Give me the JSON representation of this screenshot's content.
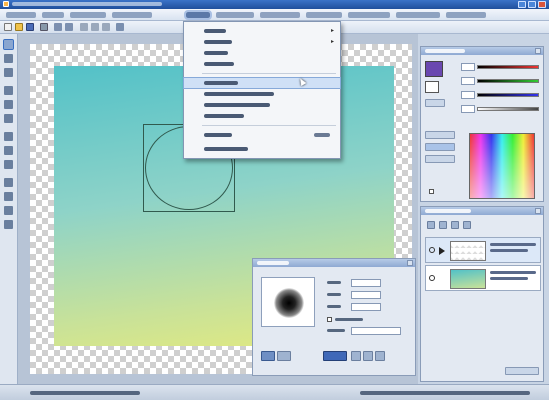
{
  "window": {
    "title": "",
    "controls": [
      "minimize",
      "maximize",
      "close"
    ]
  },
  "menubar": {
    "items": [
      {
        "label": "",
        "active": false
      },
      {
        "label": "",
        "active": false
      },
      {
        "label": "",
        "active": false
      },
      {
        "label": "",
        "active": false
      },
      {
        "label": "",
        "active": true
      },
      {
        "label": "",
        "active": false
      },
      {
        "label": "",
        "active": false
      },
      {
        "label": "",
        "active": false
      },
      {
        "label": "",
        "active": false
      },
      {
        "label": "",
        "active": false
      },
      {
        "label": "",
        "active": false
      }
    ]
  },
  "toolbar": {
    "icons": [
      "new-file-icon",
      "open-folder-icon",
      "save-icon",
      "print-icon",
      "undo-icon",
      "redo-icon",
      "cut-icon",
      "copy-icon",
      "paste-icon",
      "zoom-icon"
    ]
  },
  "toolbox": {
    "tools": [
      "select-tool-icon",
      "move-tool-icon",
      "lasso-tool-icon",
      "pen-tool-icon",
      "brush-tool-icon",
      "eraser-tool-icon",
      "fill-tool-icon",
      "gradient-tool-icon",
      "text-tool-icon",
      "shape-tool-icon",
      "eyedropper-tool-icon",
      "hand-tool-icon",
      "zoom-tool-icon"
    ]
  },
  "layer_menu": {
    "items": [
      {
        "label": "",
        "shortcut": "",
        "submenu": true,
        "highlighted": false
      },
      {
        "label": "",
        "shortcut": "",
        "submenu": true,
        "highlighted": false
      },
      {
        "label": "",
        "shortcut": "",
        "submenu": false,
        "highlighted": false
      },
      {
        "label": "",
        "shortcut": "",
        "submenu": false,
        "highlighted": false
      },
      {
        "label": "",
        "shortcut": "",
        "submenu": false,
        "highlighted": true
      },
      {
        "label": "",
        "shortcut": "",
        "submenu": false,
        "highlighted": false
      },
      {
        "label": "",
        "shortcut": "",
        "submenu": false,
        "highlighted": false
      },
      {
        "label": "",
        "shortcut": "",
        "submenu": false,
        "highlighted": false
      },
      {
        "label": "",
        "shortcut": "",
        "submenu": false,
        "highlighted": false
      },
      {
        "label": "",
        "shortcut": "",
        "submenu": false,
        "highlighted": false
      }
    ]
  },
  "color_panel": {
    "title": "",
    "main_color": "#6a48b0",
    "sub_color": "#ffffff"
  },
  "layers_panel": {
    "title": "",
    "layers": [
      {
        "name": "",
        "info": "",
        "thumbnail": "transparent"
      },
      {
        "name": "",
        "info": "",
        "thumbnail": "gradient"
      }
    ]
  },
  "brush_panel": {
    "title": ""
  },
  "canvas": {
    "gradient_colors": [
      "#52c1c8",
      "#8ed3c8",
      "#c9e298",
      "#e4ea7e"
    ]
  },
  "status": {
    "left": "",
    "right": ""
  }
}
